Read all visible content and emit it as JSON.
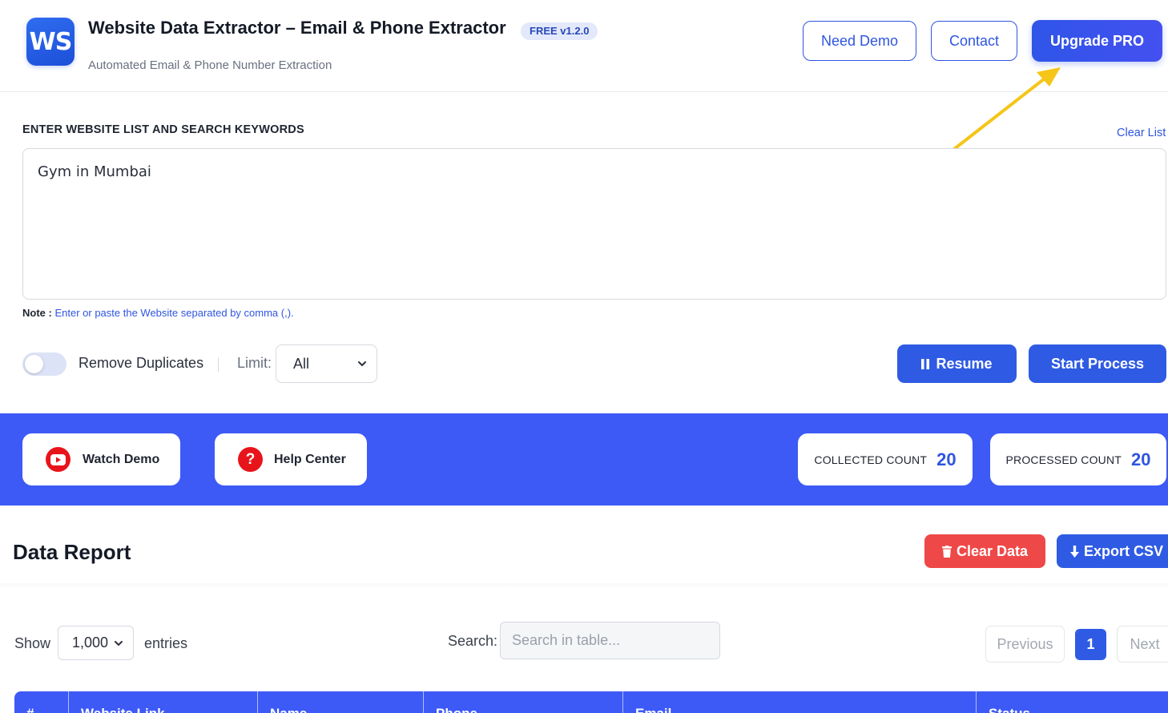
{
  "header": {
    "logo_text": "WS",
    "title": "Website Data Extractor – Email & Phone Extractor",
    "version": "FREE v1.2.0",
    "subtitle": "Automated Email & Phone Number Extraction",
    "need_demo": "Need Demo",
    "contact": "Contact",
    "upgrade": "Upgrade PRO"
  },
  "input": {
    "label": "ENTER WEBSITE LIST AND SEARCH KEYWORDS",
    "clear_list": "Clear List",
    "value": "Gym in Mumbai",
    "note_label": "Note :",
    "note_text": "Enter or paste the Website separated by comma (,)."
  },
  "options": {
    "remove_duplicates_label": "Remove Duplicates",
    "remove_duplicates_on": false,
    "limit_label": "Limit:",
    "limit_value": "All",
    "resume": "Resume",
    "start": "Start Process"
  },
  "band": {
    "watch_demo": "Watch Demo",
    "help_center": "Help Center",
    "help_icon_glyph": "?",
    "collected_label": "COLLECTED COUNT",
    "collected_value": "20",
    "processed_label": "PROCESSED COUNT",
    "processed_value": "20"
  },
  "report": {
    "title": "Data Report",
    "clear_data": "Clear Data",
    "export_csv": "Export CSV",
    "show_label": "Show",
    "entries_value": "1,000",
    "entries_label": "entries",
    "search_label": "Search:",
    "search_placeholder": "Search in table...",
    "pagination": {
      "previous": "Previous",
      "current": "1",
      "next": "Next"
    },
    "columns": [
      "#",
      "Website Link",
      "Name",
      "Phone",
      "Email",
      "Status"
    ]
  },
  "colors": {
    "primary": "#2f55e0",
    "band": "#3d5af6",
    "danger": "#ef4848",
    "youtube": "#e8141b",
    "arrow": "#f5c518"
  },
  "icons": {
    "resume": "pause-icon",
    "clear_data": "trash-icon",
    "export_csv": "download-icon",
    "watch_demo": "youtube-icon",
    "help_center": "question-icon"
  }
}
